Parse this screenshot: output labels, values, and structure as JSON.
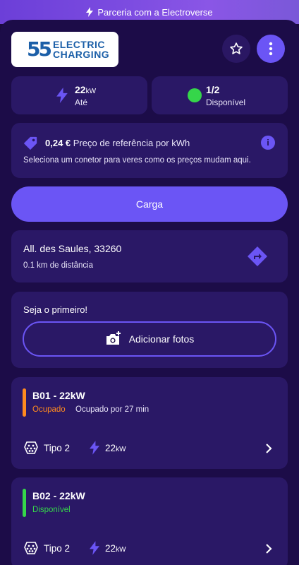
{
  "banner": {
    "text": "Parceria com a Electroverse"
  },
  "logo": {
    "mark": "55",
    "line1": "ELECTRIC",
    "line2": "CHARGING"
  },
  "stats": {
    "power_value": "22",
    "power_unit": "kW",
    "power_label": "Até",
    "availability_value": "1/2",
    "availability_label": "Disponível"
  },
  "price": {
    "amount": "0,24 €",
    "label": "Preço de referência por kWh",
    "note": "Seleciona um conetor para veres como os preços mudam aqui.",
    "info_glyph": "i"
  },
  "charge_button": {
    "label": "Carga"
  },
  "location": {
    "address": "All. des Saules, 33260",
    "distance": "0.1 km de distância"
  },
  "photos": {
    "title": "Seja o primeiro!",
    "button_label": "Adicionar fotos"
  },
  "connectors": [
    {
      "title": "B01 - 22kW",
      "status": "Ocupado",
      "status_color": "#ff8a1f",
      "since": "Ocupado por 27 min",
      "type": "Tipo 2",
      "power": "22",
      "unit": "kW"
    },
    {
      "title": "B02 - 22kW",
      "status": "Disponível",
      "status_color": "#35d64a",
      "since": "",
      "type": "Tipo 2",
      "power": "22",
      "unit": "kW"
    }
  ],
  "colors": {
    "background": "#1c0c48",
    "card": "#2a1866",
    "accent": "#6b55f5",
    "available": "#35d64a",
    "occupied": "#ff8a1f"
  },
  "icons": {
    "banner": "bolt-icon",
    "favorite": "star-icon",
    "more": "more-vertical-icon",
    "power": "bolt-icon",
    "availability": "status-dot-icon",
    "price": "tag-icon",
    "info": "info-icon",
    "directions": "directions-icon",
    "camera": "camera-add-icon",
    "connector": "type2-plug-icon",
    "chevron": "chevron-right-icon"
  }
}
